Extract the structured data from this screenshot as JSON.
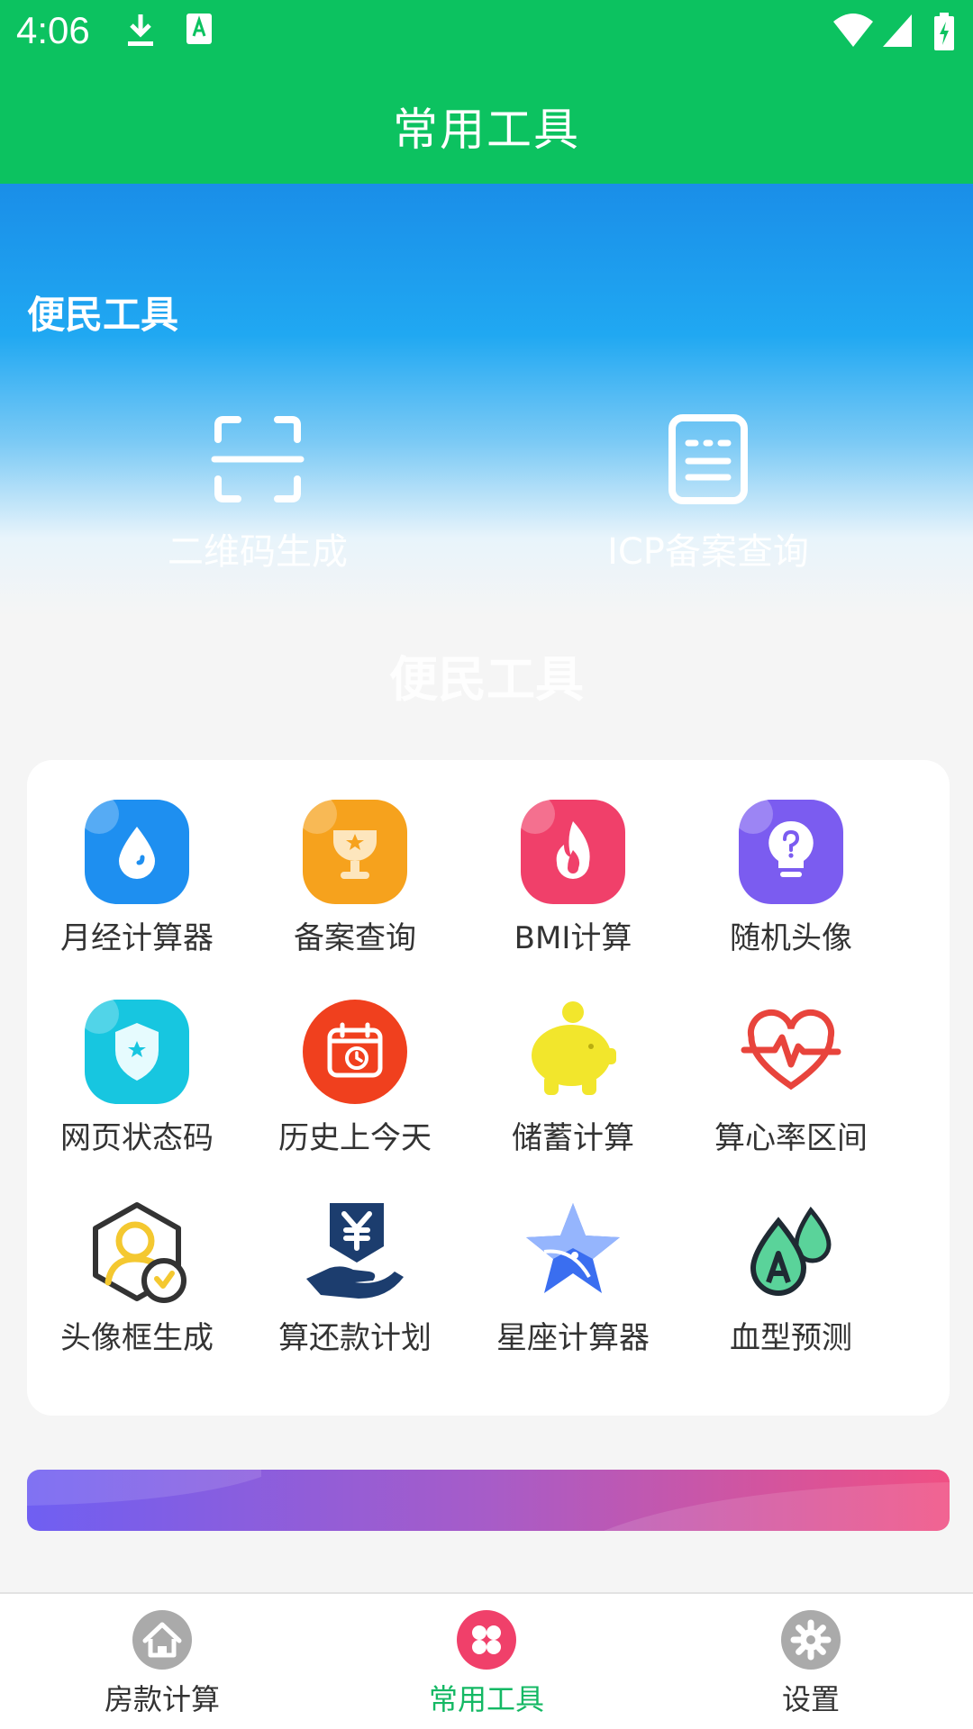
{
  "status_bar": {
    "time": "4:06"
  },
  "app_bar": {
    "title": "常用工具"
  },
  "hero": {
    "section_title": "便民工具",
    "quick_tools": [
      {
        "label": "二维码生成",
        "icon": "qr-scan-icon"
      },
      {
        "label": "ICP备案查询",
        "icon": "document-icon"
      }
    ],
    "watermark": "便民工具"
  },
  "tools": [
    {
      "label": "月经计算器",
      "icon": "water-drop-icon",
      "color": "#1e8ff0"
    },
    {
      "label": "备案查询",
      "icon": "trophy-icon",
      "color": "#f6a21d"
    },
    {
      "label": "BMI计算",
      "icon": "flame-icon",
      "color": "#f0406a"
    },
    {
      "label": "随机头像",
      "icon": "lightbulb-question-icon",
      "color": "#7b5cf0"
    },
    {
      "label": "网页状态码",
      "icon": "shield-star-icon",
      "color": "#17c6e0"
    },
    {
      "label": "历史上今天",
      "icon": "calendar-history-icon",
      "color": "#f0401e"
    },
    {
      "label": "储蓄计算",
      "icon": "piggy-bank-icon",
      "color": "#f2e62c"
    },
    {
      "label": "算心率区间",
      "icon": "heart-rate-icon",
      "color": "#e8443c"
    },
    {
      "label": "头像框生成",
      "icon": "avatar-frame-icon",
      "color": "#f4c830"
    },
    {
      "label": "算还款计划",
      "icon": "yuan-hand-icon",
      "color": "#1c3d6e"
    },
    {
      "label": "星座计算器",
      "icon": "star-icon",
      "color": "#3a6ef0"
    },
    {
      "label": "血型预测",
      "icon": "blood-drops-icon",
      "color": "#2f9a6a"
    }
  ],
  "tab_bar": {
    "items": [
      {
        "label": "房款计算",
        "icon": "home-icon",
        "active": false
      },
      {
        "label": "常用工具",
        "icon": "clover-icon",
        "active": true
      },
      {
        "label": "设置",
        "icon": "gear-icon",
        "active": false
      }
    ]
  },
  "colors": {
    "primary": "#0cc260",
    "active_tab": "#14b864",
    "inactive_tab_icon": "#aaaaaa"
  }
}
